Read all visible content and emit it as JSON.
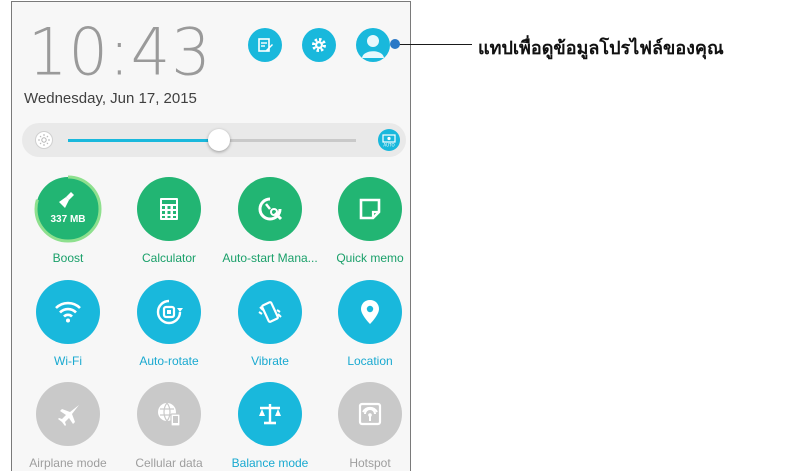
{
  "status": {
    "time": "10:43",
    "date": "Wednesday, Jun 17, 2015"
  },
  "header_buttons": [
    {
      "icon": "edit-icon"
    },
    {
      "icon": "settings-icon"
    },
    {
      "icon": "profile-icon"
    }
  ],
  "brightness": {
    "level_percent": 54,
    "auto_label": "AUTO"
  },
  "tiles": {
    "boost": {
      "label": "Boost",
      "value": "337 MB",
      "icon": "broom-icon",
      "ring_percent": 80
    },
    "calculator": {
      "label": "Calculator",
      "icon": "calculator-icon"
    },
    "autostart": {
      "label": "Auto-start Mana...",
      "icon": "autostart-icon"
    },
    "quickmemo": {
      "label": "Quick memo",
      "icon": "memo-icon"
    },
    "wifi": {
      "label": "Wi-Fi",
      "icon": "wifi-icon"
    },
    "autorotate": {
      "label": "Auto-rotate",
      "icon": "rotate-icon"
    },
    "vibrate": {
      "label": "Vibrate",
      "icon": "vibrate-icon"
    },
    "location": {
      "label": "Location",
      "icon": "location-icon"
    },
    "airplane": {
      "label": "Airplane mode",
      "icon": "airplane-icon"
    },
    "cellular": {
      "label": "Cellular data",
      "icon": "cellular-icon"
    },
    "balance": {
      "label": "Balance mode",
      "icon": "balance-icon"
    },
    "hotspot": {
      "label": "Hotspot",
      "icon": "hotspot-icon"
    }
  },
  "callout": {
    "text": "แทปเพื่อดูข้อมูลโปรไฟล์ของคุณ"
  },
  "colors": {
    "accent_blue": "#19b8dc",
    "accent_green": "#22b573",
    "disabled_gray": "#c9c9c9"
  }
}
